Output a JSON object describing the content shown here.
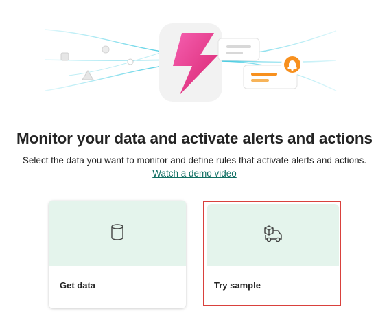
{
  "header": {
    "title": "Monitor your data and activate alerts and actions",
    "subtitle": "Select the data you want to monitor and define rules that activate alerts and actions.",
    "demo_link": "Watch a demo video"
  },
  "cards": [
    {
      "label": "Get data",
      "icon": "database-icon"
    },
    {
      "label": "Try sample",
      "icon": "delivery-truck-icon"
    }
  ],
  "colors": {
    "accent_link": "#0f6e62",
    "card_top": "#e4f4ec",
    "highlight_border": "#d9413d",
    "bolt_pink": "#e8378f",
    "alert_orange": "#f7901e"
  }
}
